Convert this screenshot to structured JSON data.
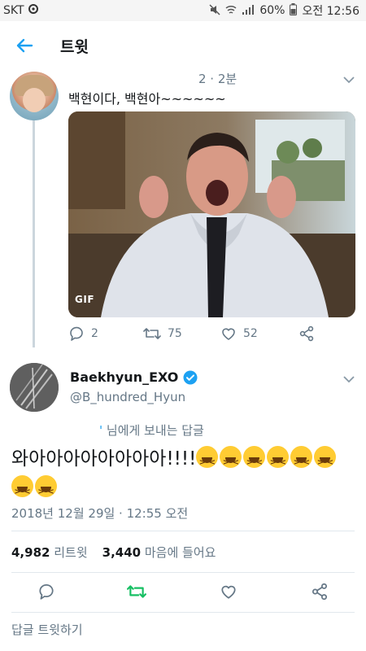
{
  "status_bar": {
    "carrier": "SKT",
    "battery": "60%",
    "time": "오전 12:56"
  },
  "header": {
    "title": "트윗"
  },
  "parent_tweet": {
    "meta": "2 · 2분",
    "text": "백현이다, 백현아~~~~~~",
    "media_badge": "GIF",
    "actions": {
      "reply_count": "2",
      "retweet_count": "75",
      "like_count": "52"
    }
  },
  "main_tweet": {
    "display_name": "Baekhyun_EXO",
    "handle": "@B_hundred_Hyun",
    "verified": true,
    "reply_to_handle": "'",
    "reply_to_suffix": " 님에게 보내는 답글",
    "text": "와아아아아아아아아!!!!",
    "emoji_count": 8,
    "timestamp": "2018년 12월 29일 · 12:55 오전",
    "stats": {
      "retweets_count": "4,982",
      "retweets_label": "리트윗",
      "likes_count": "3,440",
      "likes_label": "마음에 들어요"
    }
  },
  "compose": {
    "placeholder": "답글 트윗하기"
  },
  "colors": {
    "accent": "#1da1f2",
    "retweet_green": "#17bf63",
    "secondary_text": "#657786"
  }
}
